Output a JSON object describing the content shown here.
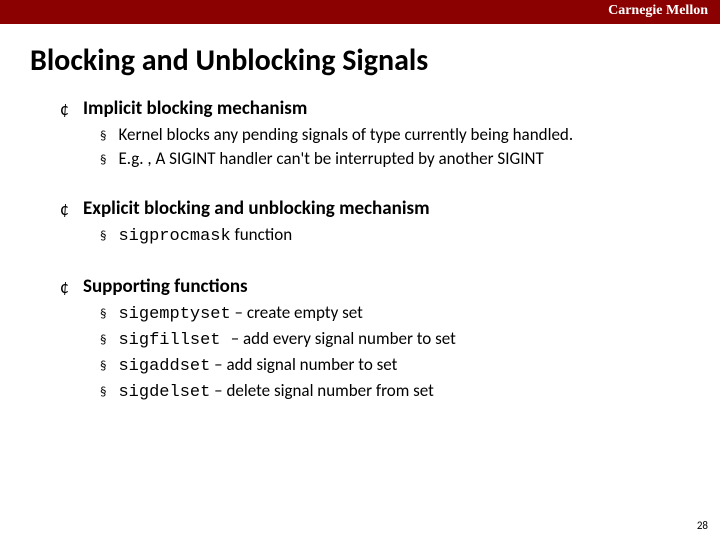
{
  "header": {
    "institution": "Carnegie Mellon"
  },
  "title": "Blocking and Unblocking Signals",
  "sections": [
    {
      "heading": "Implicit blocking mechanism",
      "items": [
        {
          "text": "Kernel blocks any pending signals of type currently being handled."
        },
        {
          "text": "E.g. , A SIGINT handler can't be interrupted by another SIGINT"
        }
      ]
    },
    {
      "heading": "Explicit blocking and unblocking mechanism",
      "items": [
        {
          "code": "sigprocmask",
          "text": " function"
        }
      ]
    },
    {
      "heading": "Supporting functions",
      "items": [
        {
          "code": "sigemptyset",
          "text": " – create empty set"
        },
        {
          "code": "sigfillset ",
          "text": "– add every signal number to set"
        },
        {
          "code": "sigaddset",
          "text": " – add signal number to set"
        },
        {
          "code": "sigdelset",
          "text": " – delete signal number from set"
        }
      ]
    }
  ],
  "bullets": {
    "circle": "¢",
    "square": "§"
  },
  "page_number": "28"
}
